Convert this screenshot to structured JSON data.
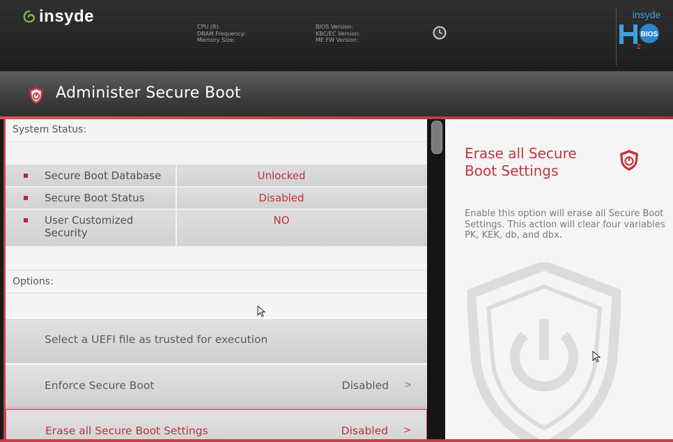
{
  "header": {
    "brand": "insyde",
    "sysinfo_left": [
      "CPU (R)",
      "DRAM Frequency:",
      "Memory Size:"
    ],
    "sysinfo_right": [
      "BIOS Version:",
      "KBC/EC Version:",
      "ME FW Version:"
    ],
    "h2_logo_top": "insyde",
    "h2_logo_badge": "BIOS"
  },
  "titlebar": {
    "title": "Administer Secure Boot"
  },
  "left": {
    "system_status_label": "System Status:",
    "status_rows": [
      {
        "name": "Secure Boot Database",
        "value": "Unlocked"
      },
      {
        "name": "Secure Boot Status",
        "value": "Disabled"
      },
      {
        "name": "User Customized Security",
        "value": "NO"
      }
    ],
    "options_label": "Options:",
    "options": [
      {
        "label": "Select a UEFI file as trusted for execution",
        "value": "",
        "chevron": ""
      },
      {
        "label": "Enforce Secure Boot",
        "value": "Disabled",
        "chevron": ">"
      },
      {
        "label": "Erase all Secure Boot Settings",
        "value": "Disabled",
        "chevron": ">"
      }
    ]
  },
  "help": {
    "title": "Erase all Secure Boot Settings",
    "text": "Enable this option will erase all Secure Boot Settings. This action will clear four variables PK, KEK, db, and dbx."
  },
  "colors": {
    "accent": "#c0303a",
    "header_bg": "#262626",
    "panel_bg": "#f4f4f4"
  }
}
